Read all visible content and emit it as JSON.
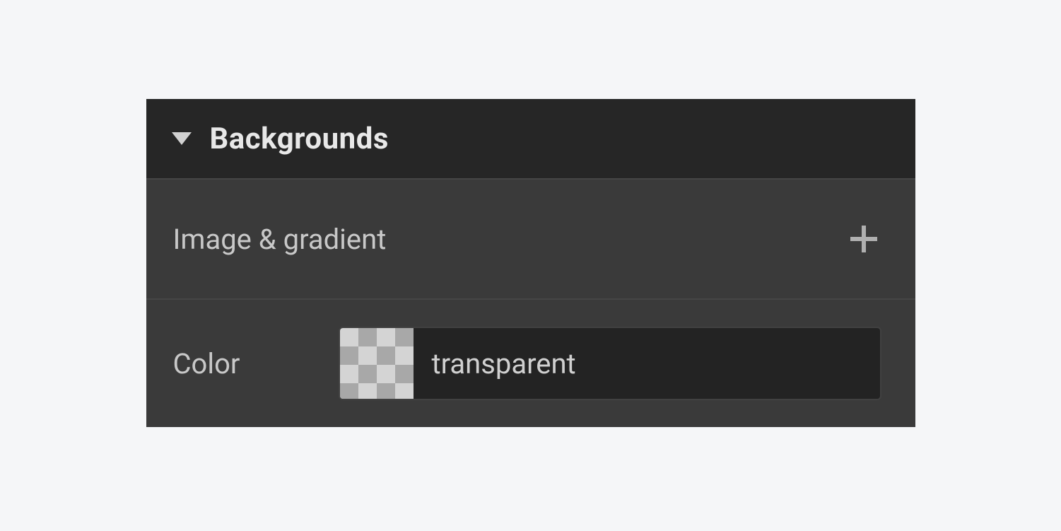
{
  "panel": {
    "title": "Backgrounds",
    "rows": {
      "imageGradient": {
        "label": "Image & gradient"
      },
      "color": {
        "label": "Color",
        "value": "transparent"
      }
    }
  }
}
